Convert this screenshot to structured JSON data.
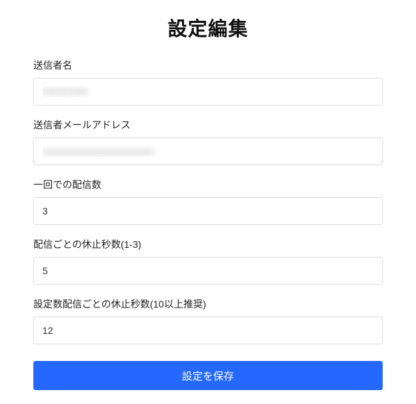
{
  "title": "設定編集",
  "fields": {
    "sender_name": {
      "label": "送信者名",
      "value": "XXXXXXX"
    },
    "sender_email": {
      "label": "送信者メールアドレス",
      "value": "xxxxxxxxxxxxxxxxxxxxxxx"
    },
    "batch_count": {
      "label": "一回での配信数",
      "value": "3"
    },
    "pause_each": {
      "label": "配信ごとの休止秒数(1-3)",
      "value": "5"
    },
    "pause_batch": {
      "label": "設定数配信ごとの休止秒数(10以上推奨)",
      "value": "12"
    }
  },
  "submit_label": "設定を保存"
}
